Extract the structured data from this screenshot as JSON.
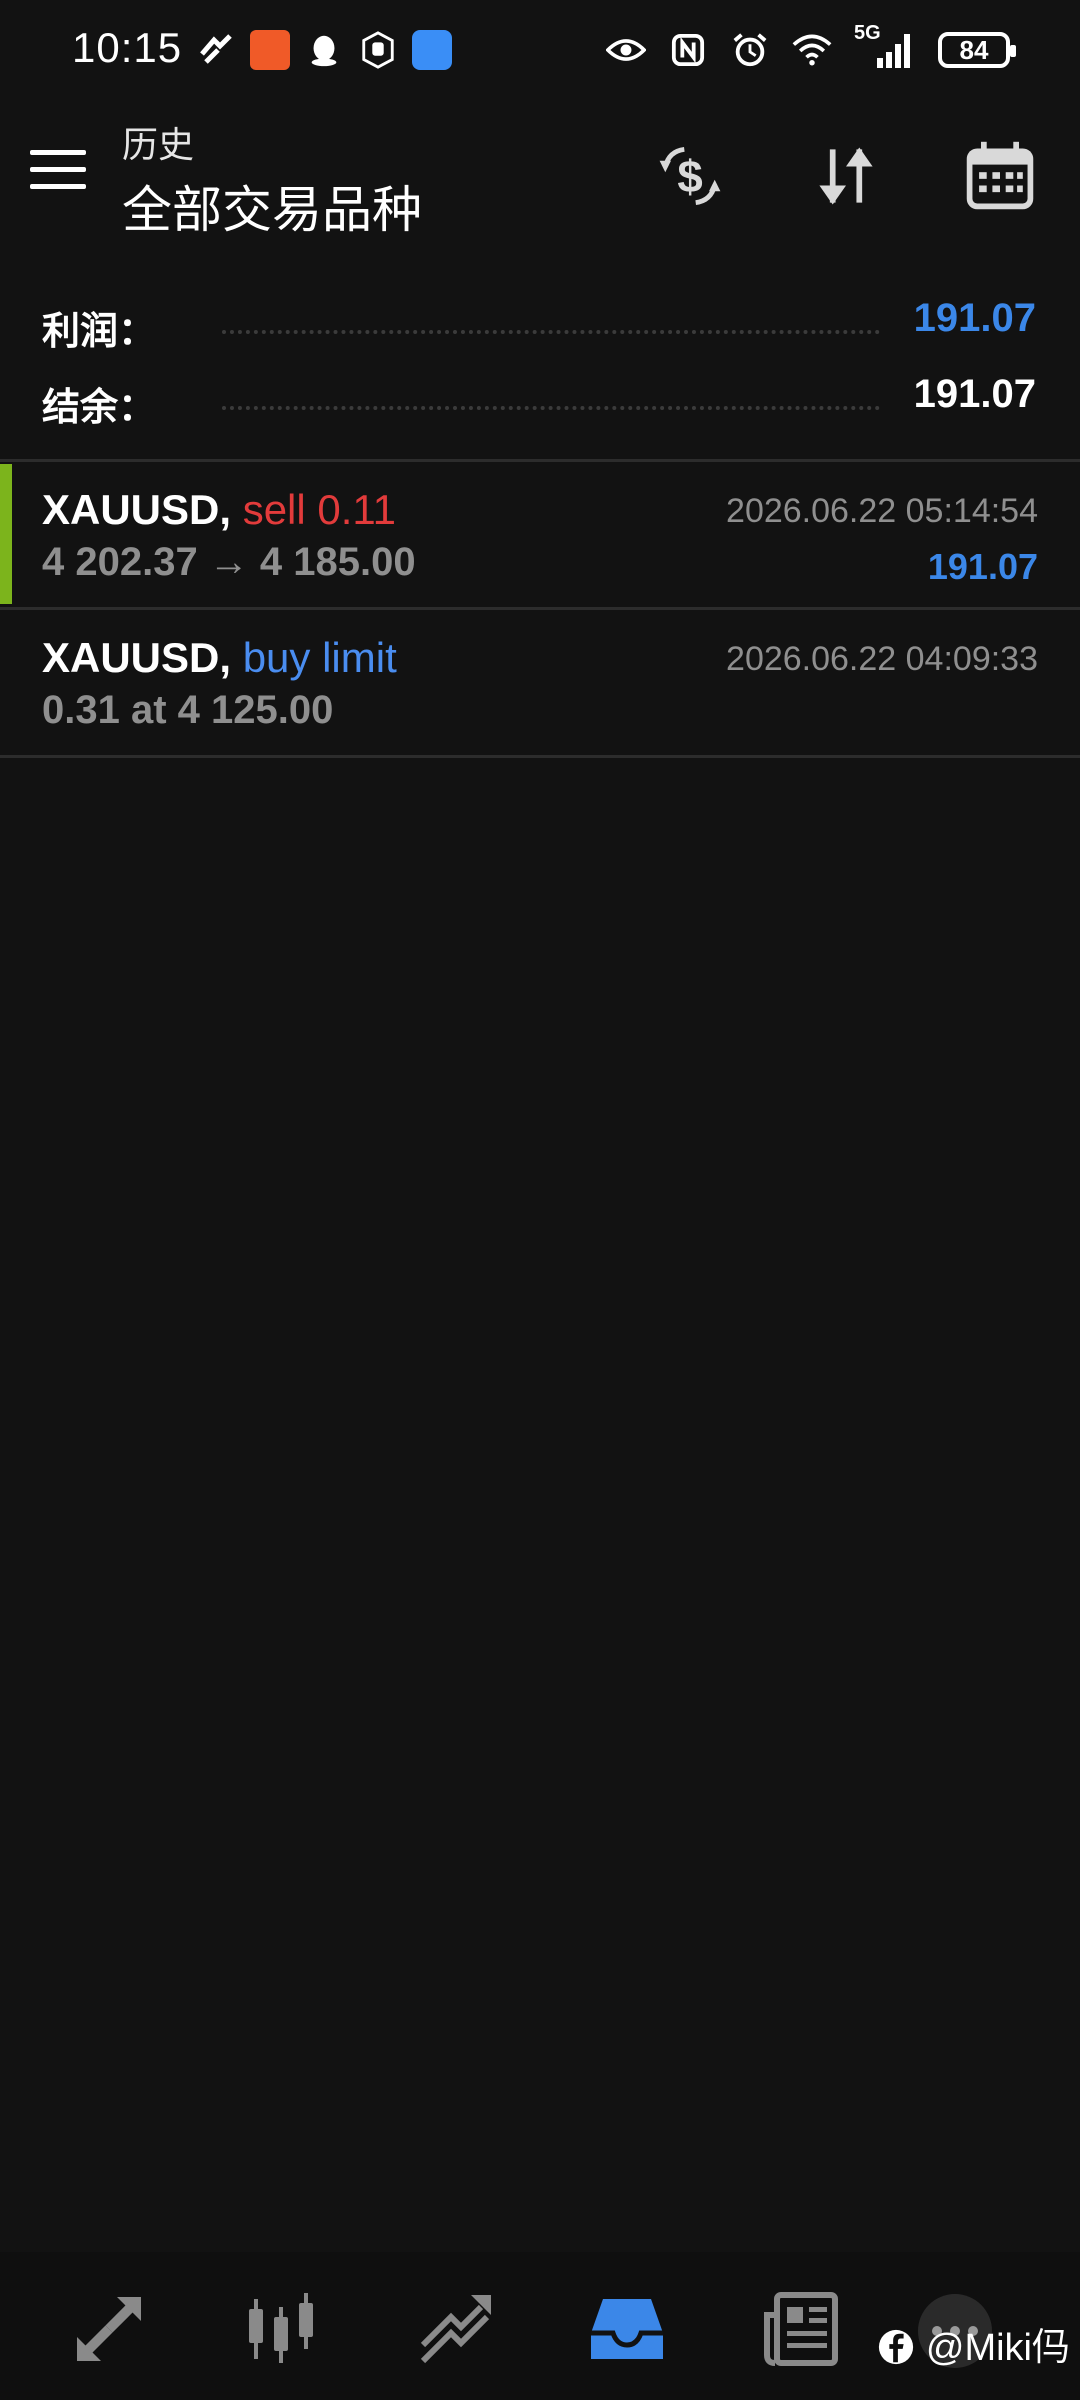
{
  "status_bar": {
    "time": "10:15",
    "network": "5G",
    "battery": "84"
  },
  "header": {
    "subtitle": "历史",
    "title": "全部交易品种"
  },
  "summary": {
    "profit_label": "利润：",
    "profit_value": "191.07",
    "balance_label": "结余：",
    "balance_value": "191.07"
  },
  "trades": [
    {
      "symbol": "XAUUSD,",
      "action": "sell 0.11",
      "prices": "4 202.37 → 4 185.00",
      "time": "2026.06.22 05:14:54",
      "profit": "191.07"
    },
    {
      "symbol": "XAUUSD,",
      "action": "buy limit",
      "prices": "0.31 at 4 125.00",
      "time": "2026.06.22 04:09:33"
    }
  ],
  "watermark": "@Miki㐷",
  "colors": {
    "background": "#121212",
    "accent_blue": "#3b87e8",
    "sell_red": "#e23b3b",
    "buy_blue": "#4a8df0",
    "trade_accent_green": "#7cb41c"
  },
  "icons": {
    "header": [
      "currency-exchange-icon",
      "sort-icon",
      "calendar-icon"
    ],
    "bottom_nav": [
      "quotes-icon",
      "chart-icon",
      "trade-icon",
      "history-icon",
      "news-icon",
      "chat-icon"
    ]
  }
}
